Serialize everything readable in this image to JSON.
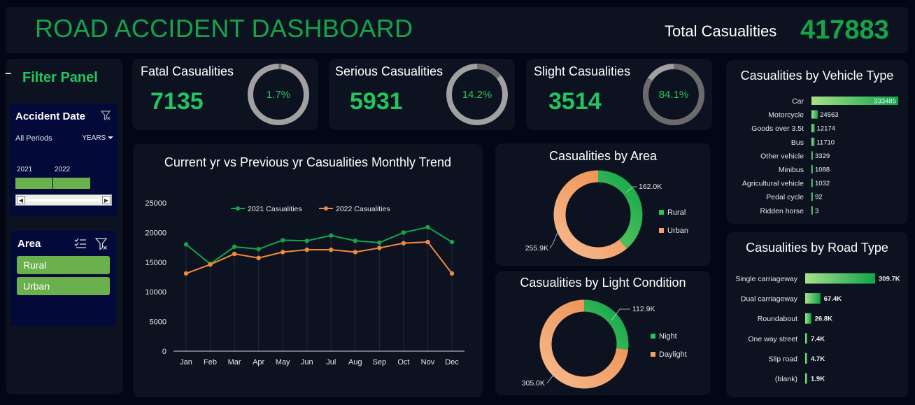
{
  "header": {
    "title": "ROAD ACCIDENT DASHBOARD",
    "total_label": "Total Casualities",
    "total_value": "417883"
  },
  "filter_panel": {
    "title": "Filter Panel",
    "date_slicer": {
      "title": "Accident Date",
      "period_text": "All Periods",
      "granularity": "YEARS",
      "years": [
        "2021",
        "2022"
      ],
      "scroll_left": "◀",
      "scroll_right": "▶"
    },
    "area_slicer": {
      "title": "Area",
      "items": [
        "Rural",
        "Urban"
      ]
    }
  },
  "kpis": [
    {
      "label": "Fatal Casualities",
      "value": "7135",
      "pct_label": "1.7%",
      "pct": 1.7
    },
    {
      "label": "Serious Casualities",
      "value": "5931",
      "pct_label": "14.2%",
      "pct": 14.2
    },
    {
      "label": "Slight Casualities",
      "value": "3514",
      "pct_label": "84.1%",
      "pct": 84.1
    }
  ],
  "colors": {
    "green": "#22c55e",
    "dark_green": "#16a34a",
    "orange": "#f08a3c",
    "ring_track": "#a1a1a1",
    "ring_fill": "#6b6b6b",
    "panel_bg": "#0c1220",
    "slicer_bg": "#030a3a",
    "slicer_button": "#6ab04c"
  },
  "chart_data": [
    {
      "type": "line",
      "title": "Current yr vs Previous yr Casualities Monthly Trend",
      "categories": [
        "Jan",
        "Feb",
        "Mar",
        "Apr",
        "May",
        "Jun",
        "Jul",
        "Aug",
        "Sep",
        "Oct",
        "Nov",
        "Dec"
      ],
      "series": [
        {
          "name": "2021 Casualities",
          "color": "#16a34a",
          "values": [
            18000,
            14700,
            17600,
            17200,
            18700,
            18600,
            19500,
            18600,
            18300,
            20000,
            20900,
            18400
          ]
        },
        {
          "name": "2022 Casualities",
          "color": "#f08a3c",
          "values": [
            13100,
            14600,
            16400,
            15700,
            16700,
            17100,
            17100,
            16700,
            17400,
            18200,
            18400,
            13100
          ]
        }
      ],
      "yticks": [
        "25000",
        "20000",
        "15000",
        "10000",
        "5000",
        "0"
      ],
      "ylim": [
        0,
        25000
      ],
      "legend": "top",
      "grid": false
    },
    {
      "type": "pie",
      "title": "Casualities by Area",
      "slices": [
        {
          "name": "Rural",
          "value": 162.0,
          "label": "162.0K",
          "color": "#22c55e"
        },
        {
          "name": "Urban",
          "value": 255.9,
          "label": "255.9K",
          "color": "#f4a070"
        }
      ],
      "legend": "right"
    },
    {
      "type": "pie",
      "title": "Casualities by Light Condition",
      "slices": [
        {
          "name": "Night",
          "value": 112.9,
          "label": "112.9K",
          "color": "#22c55e"
        },
        {
          "name": "Daylight",
          "value": 305.0,
          "label": "305.0K",
          "color": "#f4a070"
        }
      ],
      "legend": "right"
    },
    {
      "type": "bar",
      "title": "Casualities by Vehicle Type",
      "categories": [
        "Car",
        "Motorcycle",
        "Goods over 3.5t",
        "Bus",
        "Other vehicle",
        "Minibus",
        "Agricultural vehicle",
        "Pedal cycle",
        "Ridden horse"
      ],
      "values": [
        333485,
        24563,
        12174,
        11710,
        3329,
        1088,
        1032,
        92,
        3
      ],
      "value_labels": [
        "333485",
        "24563",
        "12174",
        "11710",
        "3329",
        "1088",
        "1032",
        "92",
        "3"
      ]
    },
    {
      "type": "bar",
      "title": "Casualities by Road Type",
      "categories": [
        "Single carriageway",
        "Dual carriageway",
        "Roundabout",
        "One way street",
        "Slip road",
        "(blank)"
      ],
      "values": [
        309.7,
        67.4,
        26.8,
        7.4,
        4.7,
        1.9
      ],
      "value_labels": [
        "309.7K",
        "67.4K",
        "26.8K",
        "7.4K",
        "4.7K",
        "1.9K"
      ]
    }
  ]
}
